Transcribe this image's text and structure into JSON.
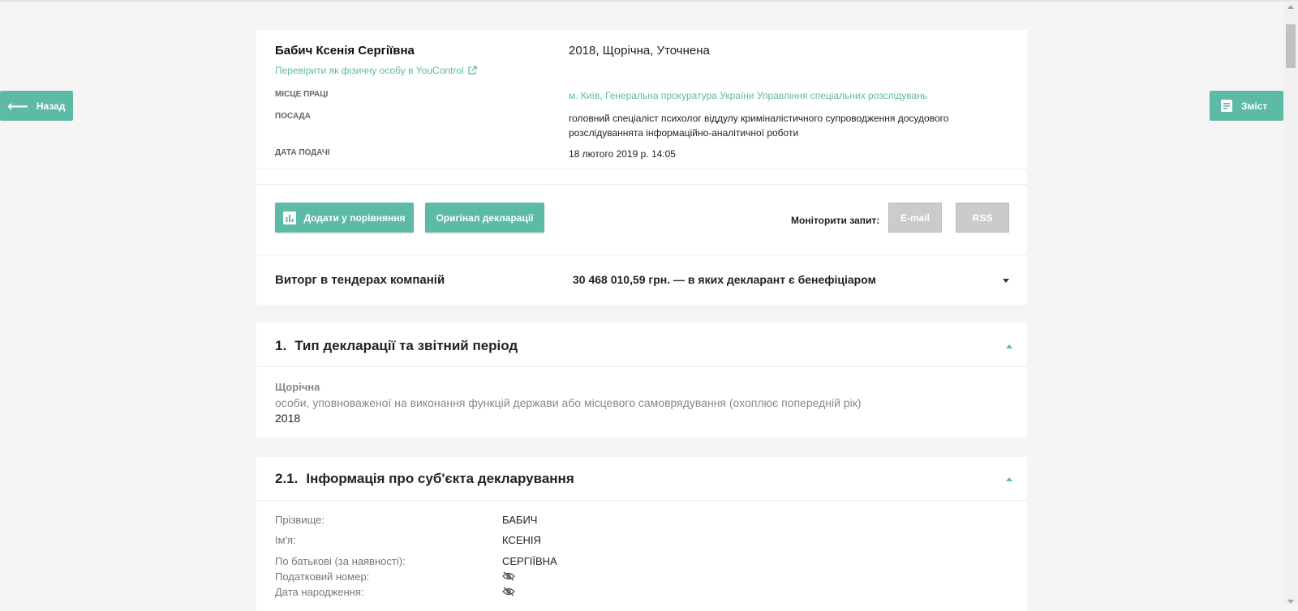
{
  "nav": {
    "back_label": "Назад",
    "toc_label": "Зміст"
  },
  "header": {
    "name": "Бабич Ксенія Сергіївна",
    "check_link": "Перевірити як фізичну особу в YouControl",
    "declaration_type": "2018, Щорічна, Уточнена",
    "workplace_label": "МІСЦЕ ПРАЦІ",
    "workplace_city": "м. Київ",
    "workplace_org": "Генеральна прокуратура України Управління спеціальних розслідувань",
    "position_label": "ПОСАДА",
    "position_value": "головний спеціаліст психолог віддулу криміналістичного супроводження досудового розслідуваннята інформаційно-аналітичної роботи",
    "date_label": "ДАТА ПОДАЧІ",
    "date_value": "18 лютого 2019 р. 14:05"
  },
  "actions": {
    "compare_label": "Додати у порівняння",
    "original_label": "Оригінал декларації",
    "monitor_label": "Моніторити запит:",
    "email_label": "E-mail",
    "rss_label": "RSS"
  },
  "tenders": {
    "label": "Виторг в тендерах компаній",
    "value": "30 468 010,59 грн. — в яких декларант є бенефіціаром"
  },
  "section1": {
    "number": "1.",
    "title": "Тип декларації та звітний період",
    "type": "Щорічна",
    "description": "особи, уповноваженої на виконання функцій держави або місцевого самоврядування (охоплює попередній рік)",
    "year": "2018"
  },
  "section2": {
    "number": "2.1.",
    "title": "Інформація про суб'єкта декларування",
    "fields": [
      {
        "label": "Прізвище:",
        "value": "БАБИЧ"
      },
      {
        "label": "Ім'я:",
        "value": "КСЕНІЯ"
      },
      {
        "label": "По батькові (за наявності):",
        "value": "СЕРГІЇВНА"
      },
      {
        "label": "Податковий номер:",
        "value": ""
      },
      {
        "label": "Дата народження:",
        "value": ""
      }
    ]
  },
  "icons": {
    "back": "arrow-left-icon",
    "toc": "document-icon",
    "compare": "bar-chart-icon",
    "external": "external-link-icon",
    "hidden": "eye-slash-icon"
  },
  "colors": {
    "accent": "#5dbaa6",
    "disabled": "#cbcbcb",
    "background": "#f5f5f5"
  }
}
